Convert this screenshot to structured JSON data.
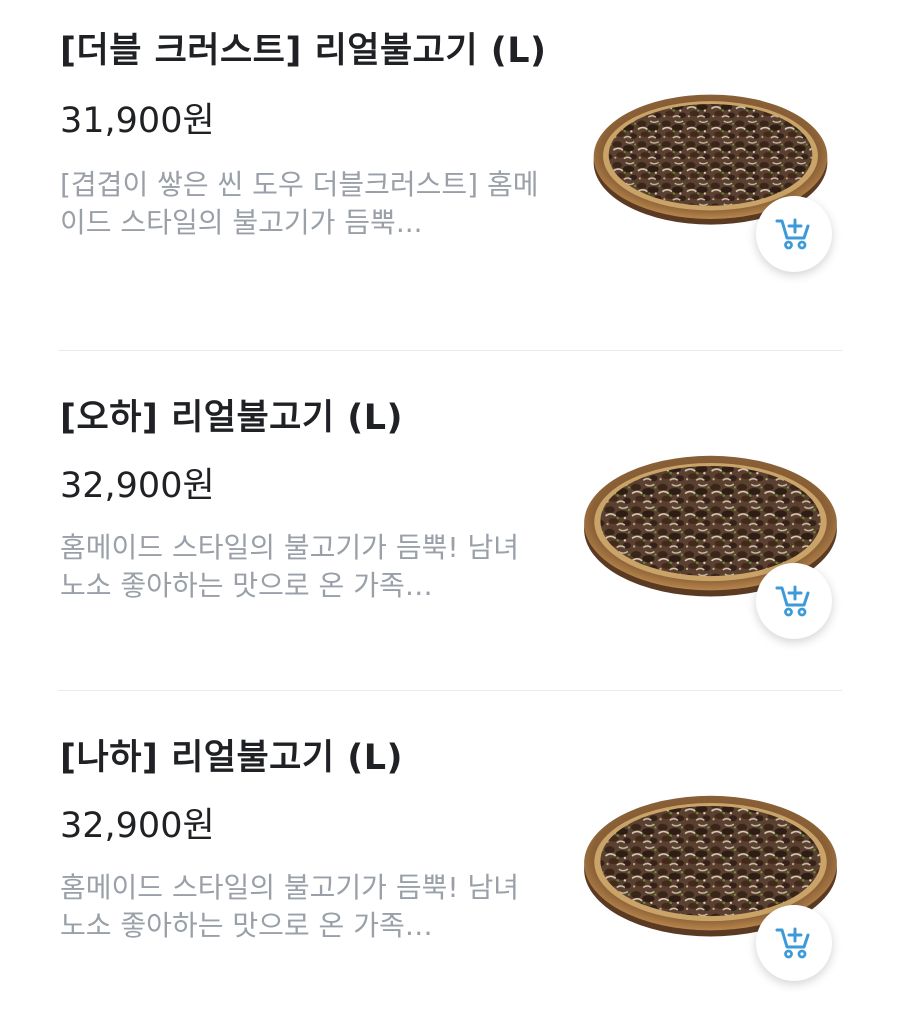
{
  "menu": {
    "items": [
      {
        "title": "[더블 크러스트] 리얼불고기 (L)",
        "price": "31,900원",
        "description": "[겹겹이 쌓은 씬 도우 더블크러스트] 홈메이드 스타일의  불고기가 듬뿍..."
      },
      {
        "title": "[오하] 리얼불고기 (L)",
        "price": "32,900원",
        "description": "홈메이드 스타일의  불고기가 듬뿍! 남녀노소 좋아하는 맛으로 온 가족…"
      },
      {
        "title": "[나하] 리얼불고기 (L)",
        "price": "32,900원",
        "description": "홈메이드 스타일의  불고기가 듬뿍! 남녀노소 좋아하는 맛으로 온 가족…"
      }
    ]
  },
  "colors": {
    "title": "#1f2124",
    "description": "#9aa0a8",
    "cart_icon": "#3d9ad8",
    "divider": "#e8e9eb"
  },
  "icons": {
    "cart": "cart-plus-icon",
    "product": "pizza-image"
  }
}
